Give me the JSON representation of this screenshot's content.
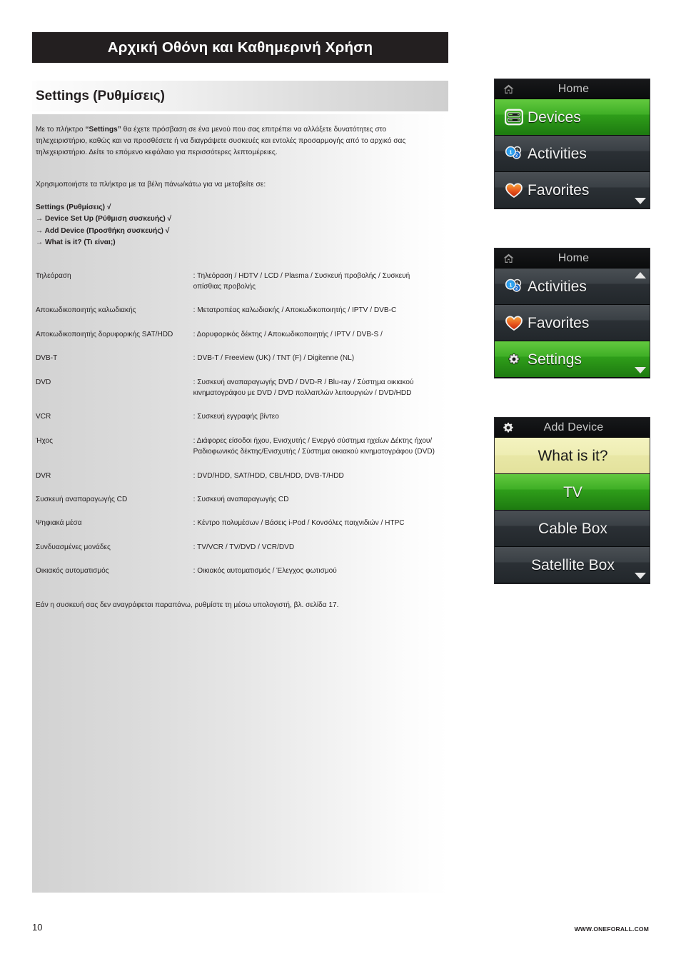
{
  "chapter": {
    "title": "Αρχική Οθόνη και Καθημερινή Χρήση"
  },
  "section": {
    "heading": "Settings (Ρυθμίσεις)",
    "intro": "Με το πλήκτρο “Settings” θα έχετε πρόσβαση σε ένα μενού που σας επιτρέπει να αλλάξετε δυνατότητες στο τηλεχειριστήριο, καθώς και να προσθέσετε ή να διαγράψετε συσκευές και εντολές προσαρμογής από το αρχικό σας τηλεχειριστήριο.  Δείτε το επόμενο κεφάλαιο για περισσότερες λεπτομέρειες.",
    "intro_bold_term": "“Settings”",
    "nav_lead": "Χρησιμοποιήστε τα πλήκτρα με τα βέλη πάνω/κάτω για να μεταβείτε σε:",
    "nav_steps": [
      "Settings (Ρυθμίσεις) √",
      "→ Device Set Up (Ρύθμιση συσκευής) √",
      "→ Add Device (Προσθήκη συσκευής) √",
      "→ What is it? (Τι είναι;)"
    ],
    "footnote": "Εάν η συσκευή σας δεν αναγράφεται παραπάνω, ρυθμίστε τη μέσω υπολογιστή, βλ. σελίδα 17."
  },
  "device_table": [
    {
      "term": "Τηλεόραση",
      "definition": "Τηλεόραση / HDTV / LCD / Plasma / Συσκευή προβολής / Συσκευή οπίσθιας προβολής"
    },
    {
      "term": "Αποκωδικοποιητής καλωδιακής",
      "definition": "Μετατροπέας καλωδιακής / Αποκωδικοποιητής / IPTV / DVB-C"
    },
    {
      "term": "Αποκωδικοποιητής δορυφορικής SAT/HDD",
      "definition": "Δορυφορικός δέκτης / Αποκωδικοποιητής / IPTV / DVB-S /"
    },
    {
      "term": "DVB-T",
      "definition": "DVB-T / Freeview (UK) / TNT (F) / Digitenne (NL)"
    },
    {
      "term": "DVD",
      "definition": "Συσκευή αναπαραγωγής DVD / DVD-R / Blu-ray / Σύστημα οικιακού κινηματογράφου με DVD / DVD πολλαπλών λειτουργιών / DVD/HDD"
    },
    {
      "term": "VCR",
      "definition": "Συσκευή εγγραφής βίντεο"
    },
    {
      "term": "Ήχος",
      "definition": "Διάφορες είσοδοι ήχου, Ενισχυτής / Ενεργό σύστημα ηχείων Δέκτης ήχου/Ραδιοφωνικός δέκτης/Ενισχυτής / Σύστημα οικιακού κινηματογράφου (DVD)"
    },
    {
      "term": "DVR",
      "definition": "DVD/HDD, SAT/HDD, CBL/HDD, DVB-T/HDD"
    },
    {
      "term": "Συσκευή αναπαραγωγής CD",
      "definition": "Συσκευή αναπαραγωγής CD"
    },
    {
      "term": "Ψηφιακά μέσα",
      "definition": "Κέντρο πολυμέσων / Βάσεις i-Pod / Κονσόλες παιχνιδιών / HTPC"
    },
    {
      "term": "Συνδυασμένες μονάδες",
      "definition": "TV/VCR / TV/DVD / VCR/DVD"
    },
    {
      "term": "Οικιακός αυτοματισμός",
      "definition": "Οικιακός αυτοματισμός / Έλεγχος φωτισμού"
    }
  ],
  "screens": [
    {
      "header": {
        "title": "Home",
        "icon": "home-icon"
      },
      "rows": [
        {
          "label": "Devices",
          "icon": "devices-icon",
          "state": "selected-green"
        },
        {
          "label": "Activities",
          "icon": "activities-icon",
          "state": "dark"
        },
        {
          "label": "Favorites",
          "icon": "favorites-heart-icon",
          "state": "dark"
        }
      ],
      "scroll": {
        "down": true,
        "up": false
      }
    },
    {
      "header": {
        "title": "Home",
        "icon": "home-icon"
      },
      "rows": [
        {
          "label": "Activities",
          "icon": "activities-icon",
          "state": "dark"
        },
        {
          "label": "Favorites",
          "icon": "favorites-heart-icon",
          "state": "dark"
        },
        {
          "label": "Settings",
          "icon": "gear-icon",
          "state": "selected-green"
        }
      ],
      "scroll": {
        "down": true,
        "up": true
      }
    },
    {
      "header": {
        "title": "Add Device",
        "icon": "gear-icon"
      },
      "rows": [
        {
          "label": "What is it?",
          "icon": "none",
          "state": "highlight-yellow"
        },
        {
          "label": "TV",
          "icon": "none",
          "state": "selected-green"
        },
        {
          "label": "Cable Box",
          "icon": "none",
          "state": "dark"
        },
        {
          "label": "Satellite Box",
          "icon": "none",
          "state": "dark"
        }
      ],
      "scroll": {
        "down": true,
        "up": false
      }
    }
  ],
  "footer": {
    "page_number": "10",
    "url": "WWW.ONEFORALL.COM"
  },
  "colors": {
    "title_bar_bg": "#231f20",
    "selected_green": "#3faf26",
    "highlight_yellow": "#eeedb3",
    "row_dark": "#3a4045",
    "screen_text": "#f2f2f2"
  }
}
